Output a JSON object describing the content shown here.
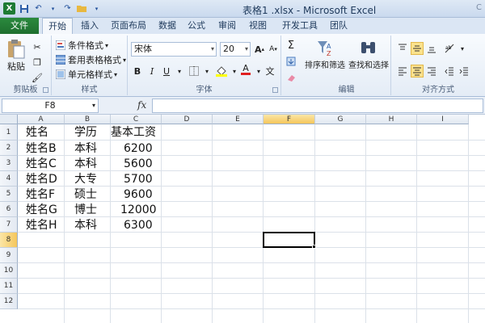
{
  "window": {
    "title": "表格1 .xlsx - Microsoft Excel",
    "title_right": "C"
  },
  "tabs": [
    "文件",
    "开始",
    "插入",
    "页面布局",
    "数据",
    "公式",
    "审阅",
    "视图",
    "开发工具",
    "团队"
  ],
  "active_tab": "开始",
  "ribbon": {
    "clipboard": {
      "paste": "粘贴",
      "label": "剪贴板"
    },
    "styles": {
      "conditional_format": "条件格式",
      "table_format": "套用表格格式",
      "cell_styles": "单元格样式",
      "label": "样式"
    },
    "font": {
      "name": "宋体",
      "size": "20",
      "grow": "A",
      "shrink": "A",
      "bold": "B",
      "italic": "I",
      "underline": "U",
      "color_letter": "A",
      "phonetic": "文",
      "label": "字体"
    },
    "editing": {
      "sigma": "Σ",
      "sort_filter": "排序和筛选",
      "find_select": "查找和选择",
      "label": "编辑"
    },
    "alignment": {
      "label": "对齐方式"
    }
  },
  "formula_bar": {
    "name_box": "F8",
    "fx": "fx",
    "value": ""
  },
  "sheet": {
    "columns": [
      "A",
      "B",
      "C",
      "D",
      "E",
      "F",
      "G",
      "H",
      "I"
    ],
    "rows": [
      "1",
      "2",
      "3",
      "4",
      "5",
      "6",
      "7",
      "8",
      "9",
      "10",
      "11",
      "12"
    ],
    "selected_column": "F",
    "selected_row": "8",
    "headers": [
      "姓名",
      "学历",
      "基本工资"
    ],
    "data": [
      [
        "姓名B",
        "本科",
        "6200"
      ],
      [
        "姓名C",
        "本科",
        "5600"
      ],
      [
        "姓名D",
        "大专",
        "5700"
      ],
      [
        "姓名F",
        "硕士",
        "9600"
      ],
      [
        "姓名G",
        "博士",
        "12000"
      ],
      [
        "姓名H",
        "本科",
        "6300"
      ]
    ]
  },
  "colors": {
    "file_tab": "#1e7b34",
    "selection_header": "#f5c65b"
  }
}
